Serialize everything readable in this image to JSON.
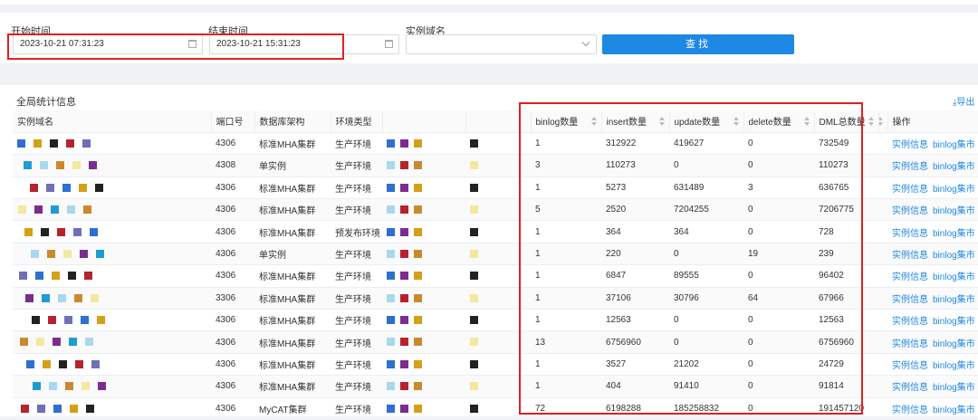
{
  "filters": {
    "start_label": "开始时间",
    "start_value": "2023-10-21 07:31:23",
    "end_label": "结束时间",
    "end_value": "2023-10-21 15:31:23",
    "domain_label": "实例域名",
    "domain_value": "",
    "search_label": "查找"
  },
  "panel": {
    "title": "全局统计信息",
    "export_label": "导出"
  },
  "table": {
    "headers": [
      "实例域名",
      "端口号",
      "数据库架构",
      "环境类型",
      "",
      "",
      "binlog数量",
      "insert数量",
      "update数量",
      "delete数量",
      "DML总数量",
      "",
      "操作"
    ],
    "actions": [
      "实例信息",
      "binlog集市"
    ],
    "rows": [
      {
        "port": "4306",
        "arch": "标准MHA集群",
        "env": "生产环境",
        "binlog": "1",
        "insert": "312922",
        "update": "419627",
        "delete": "0",
        "dml": "732549"
      },
      {
        "port": "4308",
        "arch": "单实例",
        "env": "生产环境",
        "binlog": "3",
        "insert": "110273",
        "update": "0",
        "delete": "0",
        "dml": "110273"
      },
      {
        "port": "4306",
        "arch": "标准MHA集群",
        "env": "生产环境",
        "binlog": "1",
        "insert": "5273",
        "update": "631489",
        "delete": "3",
        "dml": "636765"
      },
      {
        "port": "4306",
        "arch": "标准MHA集群",
        "env": "生产环境",
        "binlog": "5",
        "insert": "2520",
        "update": "7204255",
        "delete": "0",
        "dml": "7206775"
      },
      {
        "port": "4306",
        "arch": "标准MHA集群",
        "env": "预发布环境",
        "binlog": "1",
        "insert": "364",
        "update": "364",
        "delete": "0",
        "dml": "728"
      },
      {
        "port": "4306",
        "arch": "单实例",
        "env": "生产环境",
        "binlog": "1",
        "insert": "220",
        "update": "0",
        "delete": "19",
        "dml": "239"
      },
      {
        "port": "4306",
        "arch": "标准MHA集群",
        "env": "生产环境",
        "binlog": "1",
        "insert": "6847",
        "update": "89555",
        "delete": "0",
        "dml": "96402"
      },
      {
        "port": "3306",
        "arch": "标准MHA集群",
        "env": "生产环境",
        "binlog": "1",
        "insert": "37106",
        "update": "30796",
        "delete": "64",
        "dml": "67966"
      },
      {
        "port": "4306",
        "arch": "标准MHA集群",
        "env": "生产环境",
        "binlog": "1",
        "insert": "12563",
        "update": "0",
        "delete": "0",
        "dml": "12563"
      },
      {
        "port": "4306",
        "arch": "标准MHA集群",
        "env": "生产环境",
        "binlog": "13",
        "insert": "6756960",
        "update": "0",
        "delete": "0",
        "dml": "6756960"
      },
      {
        "port": "4306",
        "arch": "标准MHA集群",
        "env": "生产环境",
        "binlog": "1",
        "insert": "3527",
        "update": "21202",
        "delete": "0",
        "dml": "24729"
      },
      {
        "port": "4306",
        "arch": "标准MHA集群",
        "env": "生产环境",
        "binlog": "1",
        "insert": "404",
        "update": "91410",
        "delete": "0",
        "dml": "91814"
      },
      {
        "port": "4306",
        "arch": "MyCAT集群",
        "env": "生产环境",
        "binlog": "72",
        "insert": "6198288",
        "update": "185258832",
        "delete": "0",
        "dml": "191457120"
      }
    ]
  },
  "colors": {
    "accent": "#1e88e5",
    "highlight": "#e02020",
    "mosaic": [
      "#2f6fd1",
      "#7b2d8e",
      "#d4a017",
      "#1f9bd1",
      "#222222",
      "#a8d8f0",
      "#b5232f",
      "#c98a2e",
      "#6f6fb8",
      "#f2e8a0"
    ]
  }
}
